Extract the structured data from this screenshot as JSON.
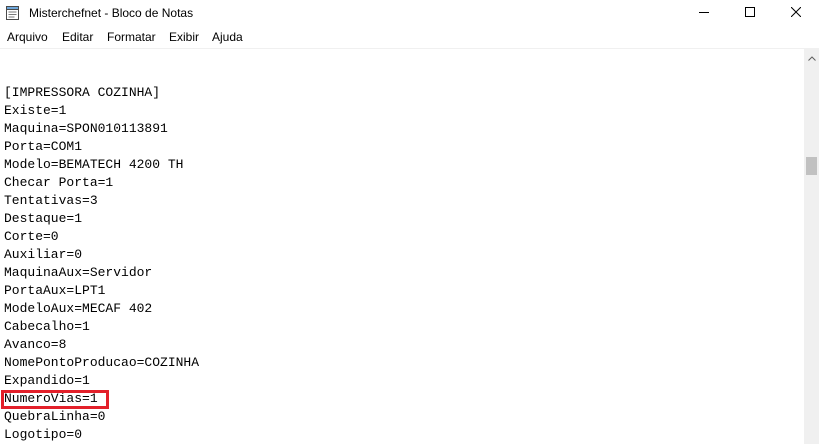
{
  "window": {
    "title": "Misterchefnet - Bloco de Notas"
  },
  "menu": {
    "items": [
      {
        "label": "Arquivo"
      },
      {
        "label": "Editar"
      },
      {
        "label": "Formatar"
      },
      {
        "label": "Exibir"
      },
      {
        "label": "Ajuda"
      }
    ]
  },
  "editor": {
    "lines": [
      "[IMPRESSORA COZINHA]",
      "Existe=1",
      "Maquina=SPON010113891",
      "Porta=COM1",
      "Modelo=BEMATECH 4200 TH",
      "Checar Porta=1",
      "Tentativas=3",
      "Destaque=1",
      "Corte=0",
      "Auxiliar=0",
      "MaquinaAux=Servidor",
      "PortaAux=LPT1",
      "ModeloAux=MECAF 402",
      "Cabecalho=1",
      "Avanco=8",
      "NomePontoProducao=COZINHA",
      "Expandido=1",
      "NumeroVias=1",
      "QuebraLinha=0",
      "Logotipo=0"
    ]
  },
  "colors": {
    "highlight": "#e3202a",
    "scroll_track": "#f0f0f0",
    "scroll_thumb": "#c1c1c1"
  }
}
